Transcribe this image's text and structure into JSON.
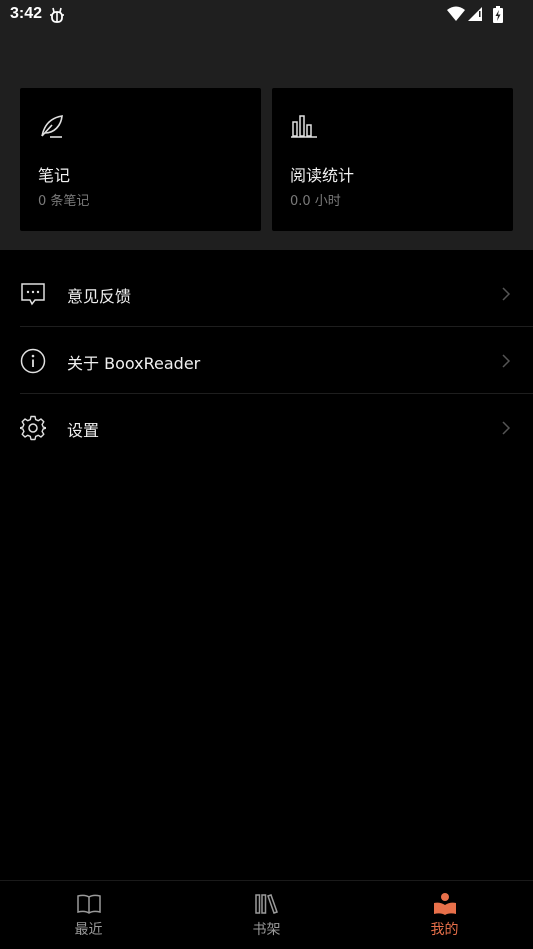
{
  "status_bar": {
    "time": "3:42",
    "app_icon": "bug-icon",
    "icons": [
      "wifi-icon",
      "signal-icon",
      "battery-charging-icon"
    ]
  },
  "cards": [
    {
      "icon": "feather-icon",
      "title": "笔记",
      "subtitle": "0 条笔记"
    },
    {
      "icon": "bar-chart-icon",
      "title": "阅读统计",
      "subtitle": "0.0 小时"
    }
  ],
  "menu": [
    {
      "icon": "feedback-icon",
      "label": "意见反馈"
    },
    {
      "icon": "info-icon",
      "label": "关于 BooxReader"
    },
    {
      "icon": "gear-icon",
      "label": "设置"
    }
  ],
  "bottom_nav": [
    {
      "icon": "book-icon",
      "label": "最近",
      "active": false
    },
    {
      "icon": "bookshelf-icon",
      "label": "书架",
      "active": false
    },
    {
      "icon": "reader-person-icon",
      "label": "我的",
      "active": true
    }
  ],
  "colors": {
    "accent": "#e8704a",
    "header_bg": "#1f1f1f",
    "background": "#000000",
    "muted_text": "#7a7a7a"
  }
}
